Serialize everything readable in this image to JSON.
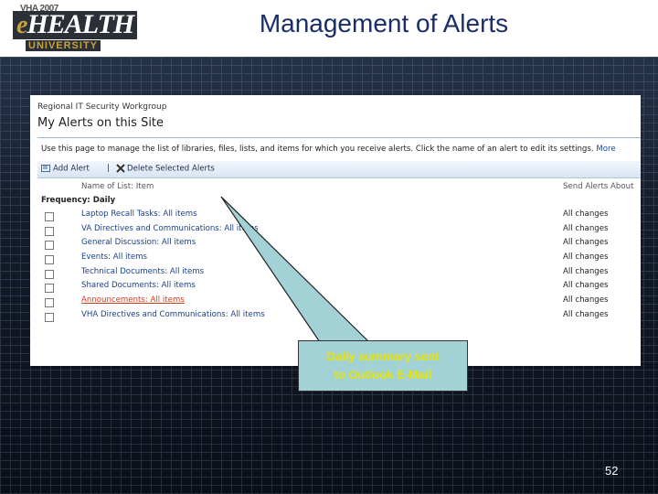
{
  "slide": {
    "title": "Management of Alerts",
    "page_number": "52"
  },
  "logo": {
    "year": "VHA 2007",
    "brand_e": "e",
    "brand_main": "HEALTH",
    "subtitle": "UNIVERSITY"
  },
  "screenshot": {
    "site_name": "Regional IT Security Workgroup",
    "page_title": "My Alerts on this Site",
    "description": "Use this page to manage the list of libraries, files, lists, and items for which you receive alerts. Click the name of an alert to edit its settings.",
    "more_link": "More",
    "toolbar": {
      "add_alert": "Add Alert",
      "separator": "|",
      "delete_alerts": "Delete Selected Alerts"
    },
    "columns": {
      "name": "Name of List: Item",
      "send": "Send Alerts About"
    },
    "frequency_label": "Frequency: Daily",
    "rows": [
      {
        "name": "Laptop Recall Tasks: All items",
        "send": "All changes"
      },
      {
        "name": "VA Directives and Communications: All items",
        "send": "All changes"
      },
      {
        "name": "General Discussion: All items",
        "send": "All changes"
      },
      {
        "name": "Events: All items",
        "send": "All changes"
      },
      {
        "name": "Technical Documents: All items",
        "send": "All changes"
      },
      {
        "name": "Shared Documents: All items",
        "send": "All changes"
      },
      {
        "name": "Announcements: All items",
        "send": "All changes"
      },
      {
        "name": "VHA Directives and Communications: All items",
        "send": "All changes"
      }
    ]
  },
  "callout": {
    "line1": "Daily summary sent",
    "line2": "to Outlook E-Mail"
  },
  "colors": {
    "title": "#1a2d6b",
    "link": "#1a3f8a",
    "active_link": "#d23a1a",
    "callout_bg": "#a3d2d6",
    "callout_text": "#e8e400"
  }
}
